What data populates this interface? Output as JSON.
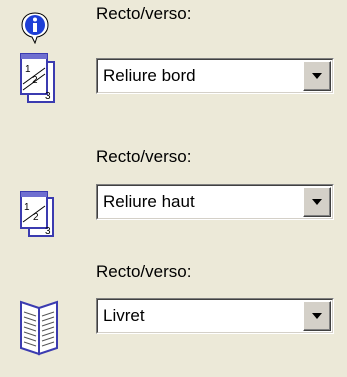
{
  "duplex_options": [
    {
      "label": "Recto/verso:",
      "value": "Reliure bord",
      "icon": "duplex-long-edge-icon"
    },
    {
      "label": "Recto/verso:",
      "value": "Reliure haut",
      "icon": "duplex-short-edge-icon"
    },
    {
      "label": "Recto/verso:",
      "value": "Livret",
      "icon": "booklet-icon"
    }
  ],
  "info_icon": "info-icon",
  "colors": {
    "background": "#ece9d8",
    "info_blue": "#1e3fd6",
    "page_blue": "#3b3bb0"
  }
}
